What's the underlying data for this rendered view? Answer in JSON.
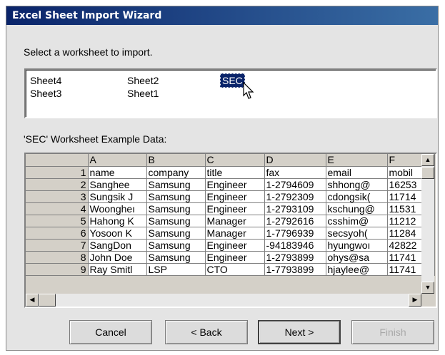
{
  "window": {
    "title": "Excel Sheet Import Wizard"
  },
  "prompt": "Select a worksheet to import.",
  "sheets": [
    {
      "name": "Sheet4",
      "selected": false
    },
    {
      "name": "Sheet3",
      "selected": false
    },
    {
      "name": "Sheet2",
      "selected": false
    },
    {
      "name": "Sheet1",
      "selected": false
    },
    {
      "name": "SEC",
      "selected": true
    }
  ],
  "example_label": "'SEC' Worksheet Example Data:",
  "grid": {
    "columns": [
      "A",
      "B",
      "C",
      "D",
      "E",
      "F"
    ],
    "rows": [
      {
        "num": "1",
        "cells": [
          "name",
          "company",
          "title",
          "fax",
          "email",
          "mobil"
        ]
      },
      {
        "num": "2",
        "cells": [
          "Sanghee",
          "Samsung",
          "Engineer",
          "1-2794609",
          "shhong@",
          "16253"
        ]
      },
      {
        "num": "3",
        "cells": [
          "Sungsik J",
          "Samsung",
          "Engineer",
          "1-2792309",
          "cdongsik(",
          "11714"
        ]
      },
      {
        "num": "4",
        "cells": [
          "Woongheı",
          "Samsung",
          "Engineer",
          "1-2793109",
          "kschung@",
          "11531"
        ]
      },
      {
        "num": "5",
        "cells": [
          "Hahong K",
          "Samsung",
          "Manager",
          "1-2792616",
          "csshim@",
          "11212"
        ]
      },
      {
        "num": "6",
        "cells": [
          "Yosoon K",
          "Samsung",
          "Manager",
          "1-7796939",
          "secsyoh(",
          "11284"
        ]
      },
      {
        "num": "7",
        "cells": [
          "SangDon",
          "Samsung",
          "Engineer",
          "-94183946",
          "hyungwoı",
          "42822"
        ]
      },
      {
        "num": "8",
        "cells": [
          "John Doe",
          "Samsung",
          "Engineer",
          "1-2793899",
          "ohys@sa",
          "11741"
        ]
      },
      {
        "num": "9",
        "cells": [
          "Ray Smitl",
          "LSP",
          "CTO",
          "1-7793899",
          "hjaylee@",
          "11741"
        ]
      }
    ]
  },
  "buttons": {
    "cancel": "Cancel",
    "back": "< Back",
    "next": "Next >",
    "finish": "Finish"
  },
  "icons": {
    "scroll_up": "▲",
    "scroll_down": "▼",
    "scroll_left": "◀",
    "scroll_right": "▶"
  }
}
